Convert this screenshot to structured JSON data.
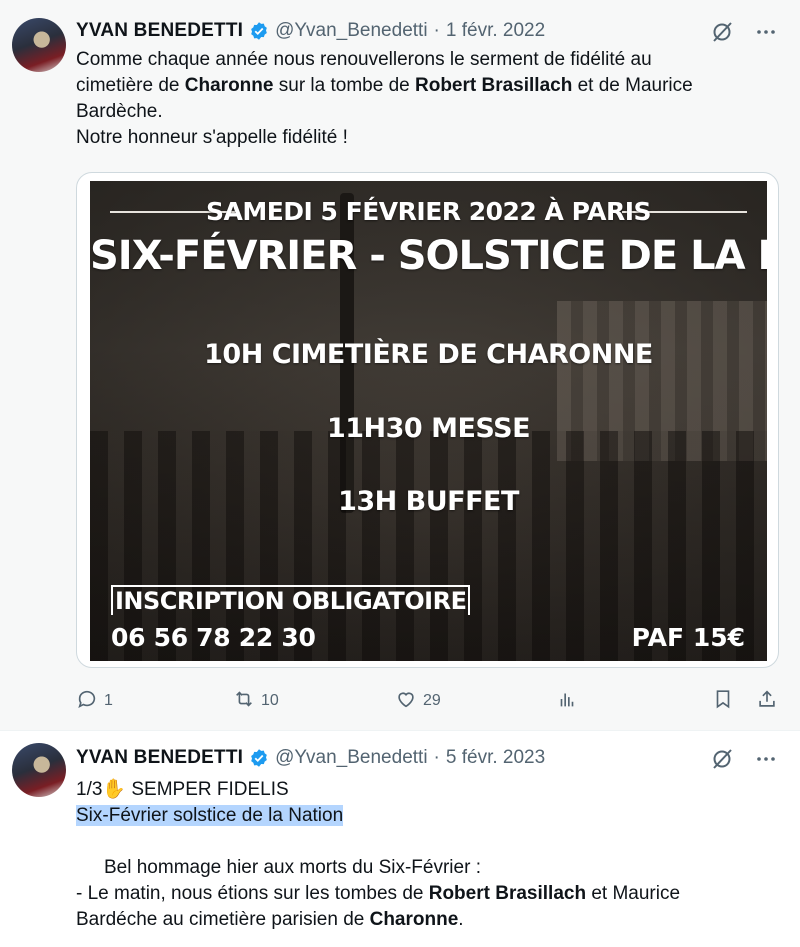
{
  "tweets": [
    {
      "author_name": "YVAN BENEDETTI",
      "handle": "@Yvan_Benedetti",
      "separator": "·",
      "date": "1 févr. 2022",
      "text": {
        "l1": "Comme chaque année nous renouvellerons le serment de fidélité au",
        "l2a": "cimetière de ",
        "l2b": "Charonne",
        "l2c": " sur la tombe de ",
        "l2d": "Robert Brasillach",
        "l2e": " et de Maurice",
        "l3": "Bardèche.",
        "l4": "Notre honneur s'appelle fidélité !"
      },
      "poster": {
        "date_line": "SAMEDI 5 FÉVRIER 2022 À PARIS",
        "title": "SIX-FÉVRIER - SOLSTICE DE LA NATION",
        "line1": "10H CIMETIÈRE DE CHARONNE",
        "line2": "11H30 MESSE",
        "line3": "13H BUFFET",
        "inscription": "INSCRIPTION OBLIGATOIRE",
        "phone": "06 56 78 22 30",
        "price": "PAF 15€"
      },
      "stats": {
        "replies": "1",
        "retweets": "10",
        "likes": "29"
      }
    },
    {
      "author_name": "YVAN BENEDETTI",
      "handle": "@Yvan_Benedetti",
      "separator": "·",
      "date": "5 févr. 2023",
      "text": {
        "l1": "1/3✋ SEMPER FIDELIS",
        "l2": "Six-Février solstice de la Nation",
        "l3": "Bel hommage hier aux morts du Six-Février :",
        "l4a": "- Le matin, nous étions sur les tombes de ",
        "l4b": "Robert Brasillach",
        "l4c": " et Maurice",
        "l5a": "Bardéche au cimetière parisien de ",
        "l5b": "Charonne",
        "l5c": "."
      }
    }
  ],
  "colors": {
    "verified": "#1d9bf0",
    "muted": "#536471",
    "highlight": "#b4d5fe"
  },
  "icons": [
    "verified-icon",
    "grok-icon",
    "more-icon",
    "reply-icon",
    "retweet-icon",
    "like-icon",
    "views-icon",
    "bookmark-icon",
    "share-icon"
  ]
}
